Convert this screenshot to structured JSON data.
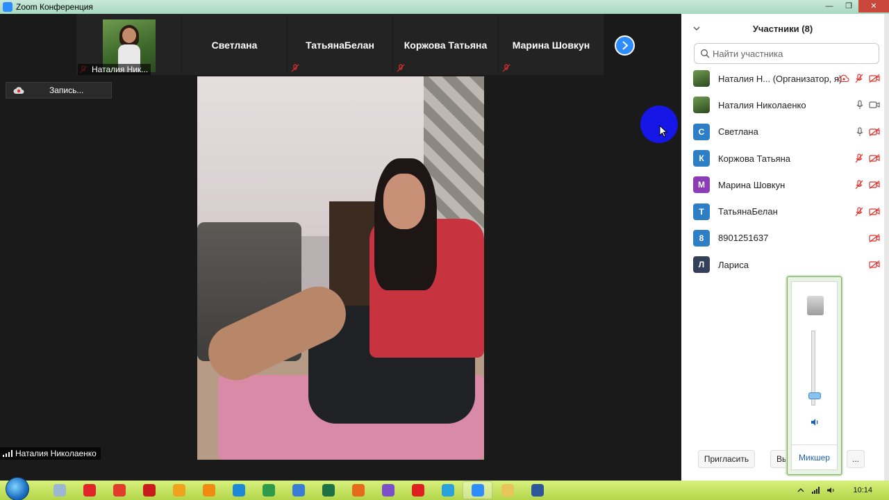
{
  "window": {
    "title": "Zoom Конференция",
    "buttons": [
      "—",
      "❐",
      "✕"
    ]
  },
  "strip": {
    "self_label": "Наталия Ник...",
    "tiles": [
      {
        "name": "Светлана"
      },
      {
        "name": "ТатьянаБелан"
      },
      {
        "name": "Коржова Татьяна"
      },
      {
        "name": "Марина Шовкун"
      }
    ]
  },
  "recording": {
    "label": "Запись..."
  },
  "main_video": {
    "speaker_name": "Наталия Николаенко"
  },
  "panel": {
    "title": "Участники (8)",
    "search_placeholder": "Найти участника",
    "participants": [
      {
        "name": "Наталия Н...  (Организатор, я)",
        "avatar": "",
        "avatar_color": "photo",
        "recording": true,
        "mic": "muted",
        "video": "off"
      },
      {
        "name": "Наталия Николаенко",
        "avatar": "",
        "avatar_color": "photo",
        "recording": false,
        "mic": "on",
        "video": "on"
      },
      {
        "name": "Светлана",
        "avatar": "С",
        "avatar_color": "#2d7ec4",
        "recording": false,
        "mic": "on",
        "video": "off"
      },
      {
        "name": "Коржова Татьяна",
        "avatar": "К",
        "avatar_color": "#2d7ec4",
        "recording": false,
        "mic": "muted",
        "video": "off"
      },
      {
        "name": "Марина Шовкун",
        "avatar": "М",
        "avatar_color": "#8b3db8",
        "recording": false,
        "mic": "muted",
        "video": "off"
      },
      {
        "name": "ТатьянаБелан",
        "avatar": "Т",
        "avatar_color": "#2d7ec4",
        "recording": false,
        "mic": "muted",
        "video": "off"
      },
      {
        "name": "8901251637",
        "avatar": "8",
        "avatar_color": "#2d7ec4",
        "recording": false,
        "mic": "none",
        "video": "off"
      },
      {
        "name": "Лариса",
        "avatar": "Л",
        "avatar_color": "#34405a",
        "recording": false,
        "mic": "none",
        "video": "off"
      }
    ],
    "footer": {
      "invite_label": "Пригласить",
      "leave_label": "Вы",
      "more_label": "..."
    }
  },
  "mixer": {
    "label": "Микшер",
    "volume_level": 0.1
  },
  "taskbar": {
    "apps": [
      {
        "icon": "notepad-icon",
        "color": "#9bb7d4"
      },
      {
        "icon": "opera-icon",
        "color": "#e0252a"
      },
      {
        "icon": "pen-icon",
        "color": "#e23b2b"
      },
      {
        "icon": "antivirus-icon",
        "color": "#c81c1c"
      },
      {
        "icon": "media-player-icon",
        "color": "#f0a21c"
      },
      {
        "icon": "vlc-icon",
        "color": "#f08a10"
      },
      {
        "icon": "internet-explorer-icon",
        "color": "#1e88d8"
      },
      {
        "icon": "chrome-icon",
        "color": "#2e9b4a"
      },
      {
        "icon": "launcher-icon",
        "color": "#3a7bd5"
      },
      {
        "icon": "excel-icon",
        "color": "#1e7145"
      },
      {
        "icon": "firefox-icon",
        "color": "#e66a1c"
      },
      {
        "icon": "viber-icon",
        "color": "#7b4fc8"
      },
      {
        "icon": "yandex-icon",
        "color": "#e02020"
      },
      {
        "icon": "telegram-icon",
        "color": "#2aa1da"
      },
      {
        "icon": "zoom-icon",
        "color": "#2d8cff"
      },
      {
        "icon": "folder-icon",
        "color": "#e8c45a"
      },
      {
        "icon": "word-icon",
        "color": "#2b579a"
      }
    ],
    "clock": "10:14"
  }
}
